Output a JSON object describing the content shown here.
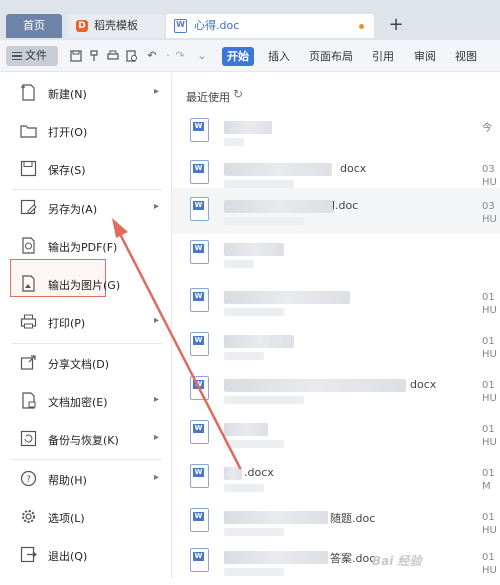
{
  "tabs": {
    "home": "首页",
    "templates": "稻壳模板",
    "document": "心得.doc",
    "add_icon": "plus-icon"
  },
  "toolbar": {
    "file_button": "文件",
    "quick_icons": [
      "save-icon",
      "format-painter-icon",
      "print-icon",
      "print-preview-icon",
      "undo-icon",
      "redo-icon",
      "customize-icon"
    ],
    "start": "开始",
    "insert": "插入",
    "page_layout": "页面布局",
    "references": "引用",
    "review": "审阅",
    "view": "视图"
  },
  "menu": {
    "items": [
      {
        "id": "new",
        "label": "新建(N)",
        "icon": "new-document-icon",
        "arrow": true
      },
      {
        "id": "open",
        "label": "打开(O)",
        "icon": "folder-icon",
        "arrow": false
      },
      {
        "id": "save",
        "label": "保存(S)",
        "icon": "save-icon",
        "arrow": false
      },
      {
        "id": "save-as",
        "label": "另存为(A)",
        "icon": "save-as-icon",
        "arrow": true
      },
      {
        "id": "export-pdf",
        "label": "输出为PDF(F)",
        "icon": "pdf-icon",
        "arrow": false
      },
      {
        "id": "export-image",
        "label": "输出为图片(G)",
        "icon": "image-icon",
        "arrow": false
      },
      {
        "id": "print",
        "label": "打印(P)",
        "icon": "print-icon",
        "arrow": true
      },
      {
        "id": "share",
        "label": "分享文档(D)",
        "icon": "share-icon",
        "arrow": false
      },
      {
        "id": "encrypt",
        "label": "文档加密(E)",
        "icon": "lock-document-icon",
        "arrow": true
      },
      {
        "id": "backup",
        "label": "备份与恢复(K)",
        "icon": "backup-icon",
        "arrow": true
      },
      {
        "id": "help",
        "label": "帮助(H)",
        "icon": "help-icon",
        "arrow": true
      },
      {
        "id": "options",
        "label": "选项(L)",
        "icon": "gear-icon",
        "arrow": false
      },
      {
        "id": "exit",
        "label": "退出(Q)",
        "icon": "exit-icon",
        "arrow": false
      }
    ],
    "arrow_glyph": "▸"
  },
  "recent": {
    "title": "最近使用",
    "column_head": "今",
    "files": [
      {
        "name": "",
        "side": [
          "",
          ""
        ]
      },
      {
        "name": "docx",
        "side": [
          "03",
          "HU"
        ]
      },
      {
        "name": "l.doc",
        "side": [
          "03",
          "HU"
        ]
      },
      {
        "name": "",
        "side": [
          "",
          ""
        ]
      },
      {
        "name": "",
        "side": [
          "01",
          "HU"
        ]
      },
      {
        "name": "",
        "side": [
          "01",
          "HU"
        ]
      },
      {
        "name": "docx",
        "side": [
          "01",
          "HU"
        ]
      },
      {
        "name": "",
        "side": [
          "01",
          "HU"
        ]
      },
      {
        "name": ".docx",
        "side": [
          "01",
          "M"
        ]
      },
      {
        "name": "随题.doc",
        "side": [
          "01",
          "HU"
        ]
      },
      {
        "name": "答案.doc",
        "side": [
          "01",
          "HU"
        ]
      }
    ]
  },
  "watermark": "Bai 经验"
}
